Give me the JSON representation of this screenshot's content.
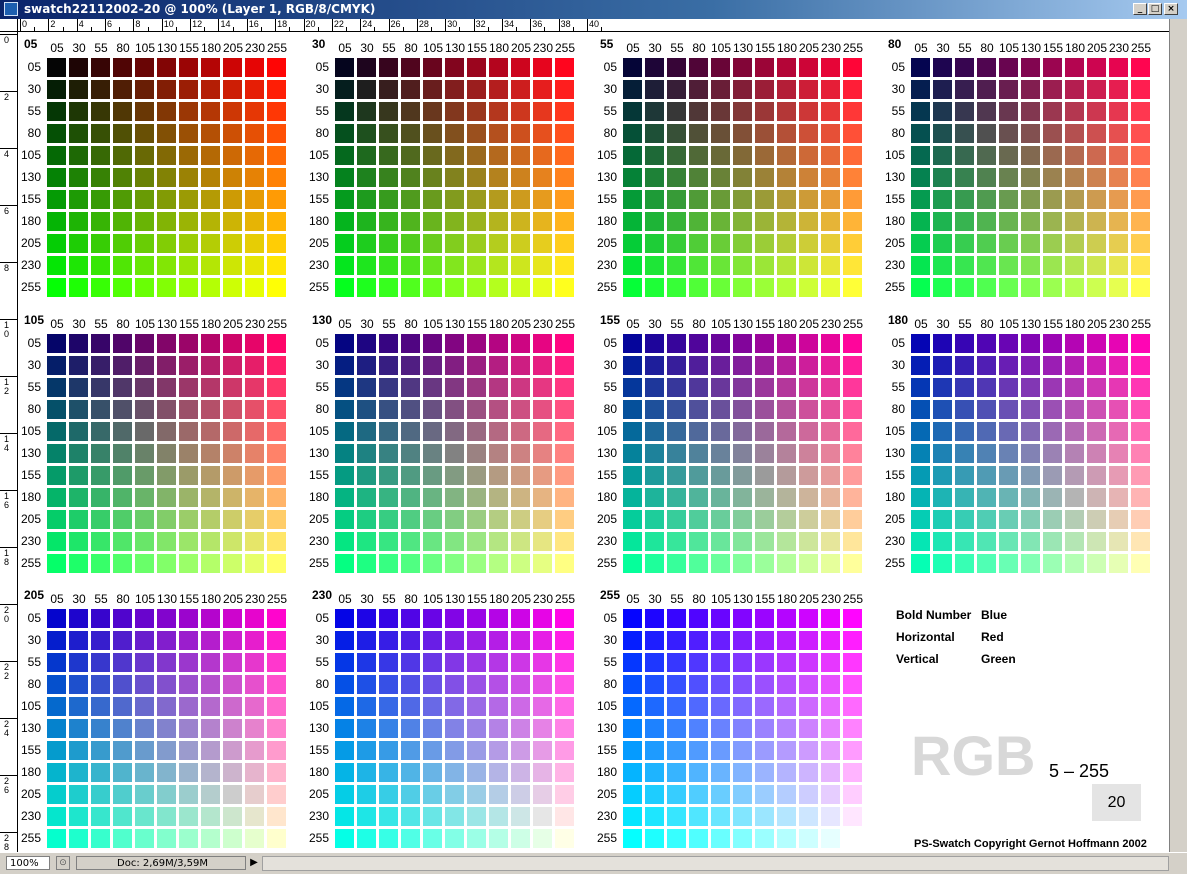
{
  "window": {
    "title": "swatch22112002-20 @ 100% (Layer 1, RGB/8/CMYK)",
    "buttons": [
      "_",
      "□",
      "×"
    ]
  },
  "rulers": {
    "top_labels": [
      "0",
      "2",
      "4",
      "6",
      "8",
      "10",
      "12",
      "14",
      "16",
      "18",
      "20",
      "22",
      "24",
      "26",
      "28",
      "30",
      "32",
      "34",
      "36",
      "38",
      "40"
    ],
    "left_labels": [
      "0",
      "2",
      "4",
      "6",
      "8",
      "10",
      "12",
      "14",
      "16",
      "18",
      "20",
      "22",
      "24",
      "26",
      "28"
    ]
  },
  "swatch": {
    "headings": [
      "05",
      "30",
      "55",
      "80",
      "105",
      "130",
      "155",
      "180",
      "205",
      "230",
      "255"
    ],
    "levels": [
      "05",
      "30",
      "55",
      "80",
      "105",
      "130",
      "155",
      "180",
      "205",
      "230",
      "255"
    ],
    "values": [
      5,
      30,
      55,
      80,
      105,
      130,
      155,
      180,
      205,
      230,
      255
    ]
  },
  "legend": {
    "rows": [
      {
        "label": "Bold Number",
        "value": "Blue"
      },
      {
        "label": "Horizontal",
        "value": "Red"
      },
      {
        "label": "Vertical",
        "value": "Green"
      }
    ],
    "big_text": "RGB",
    "range": "5 – 255",
    "page_number": "20",
    "copyright": "PS-Swatch Copyright Gernot Hoffmann 2002"
  },
  "status": {
    "zoom": "100%",
    "doc_info": "Doc: 2,69M/3,59M",
    "arrow": "▶"
  }
}
